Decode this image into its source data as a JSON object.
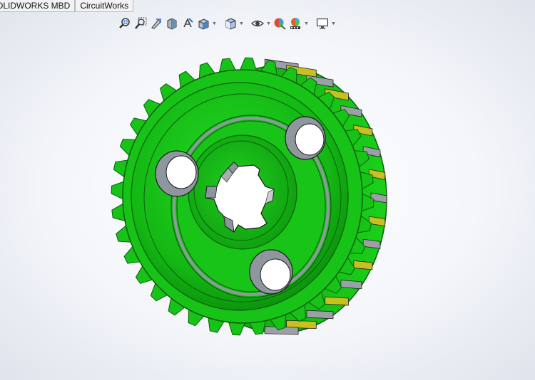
{
  "tabs": [
    {
      "label": "OLIDWORKS MBD"
    },
    {
      "label": "CircuitWorks"
    }
  ],
  "toolbar": {
    "icons": [
      "zoom-to-fit-icon",
      "zoom-to-area-icon",
      "previous-view-icon",
      "section-view-icon",
      "dynamic-annotation-view-icon",
      "view-orientation-icon",
      "display-style-icon",
      "hide-show-items-icon",
      "edit-appearance-icon",
      "apply-scene-icon",
      "view-settings-icon"
    ]
  },
  "model": {
    "name": "timing-pulley",
    "body_color": "#17c317",
    "tooth_face_color": "#c8c020",
    "bore_color": "#9aa0a6"
  },
  "colors": {
    "background": "#f4f6fa"
  }
}
